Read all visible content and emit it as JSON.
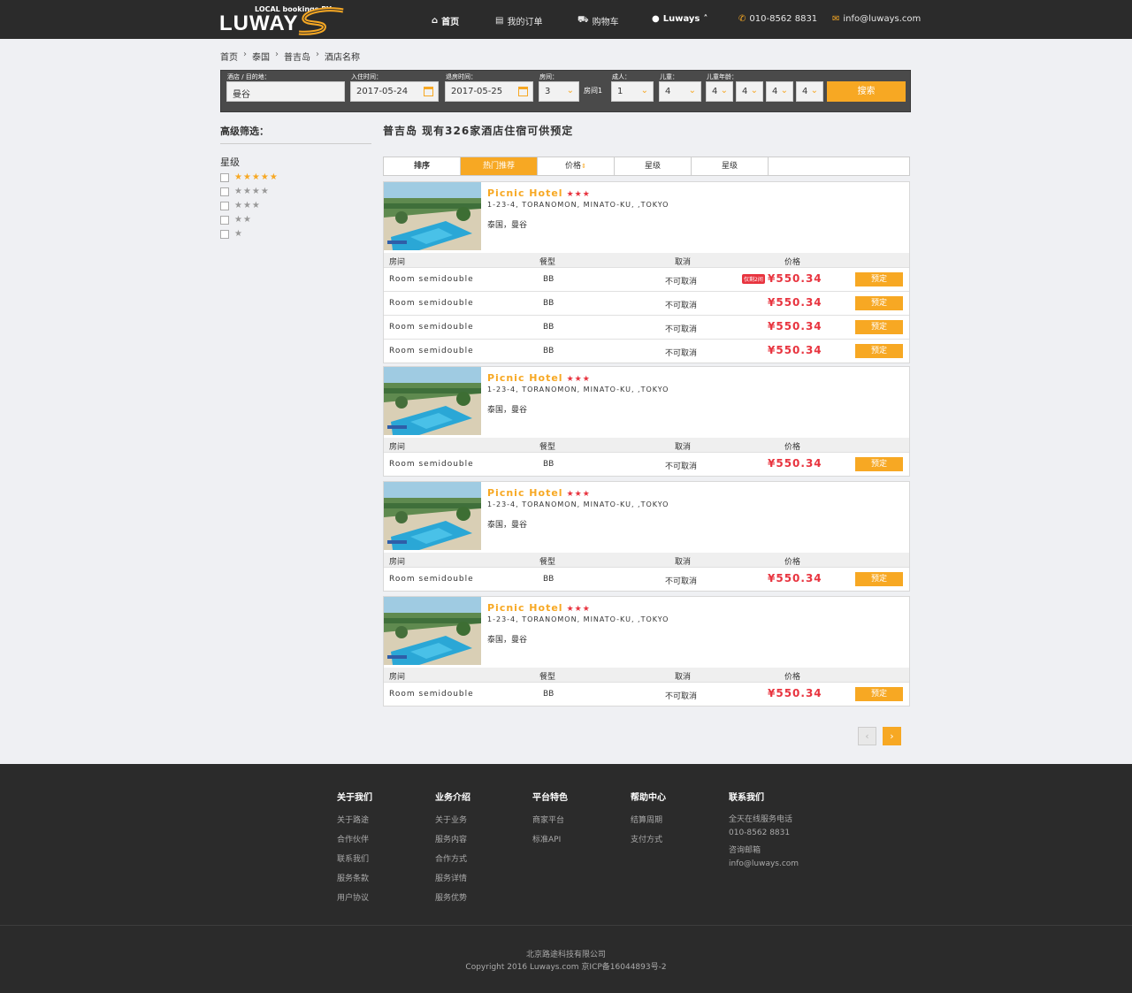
{
  "header": {
    "logo_small": "LOCAL bookings BY",
    "logo_text": "LUWAY",
    "nav": [
      {
        "label": "首页",
        "icon": "home-icon"
      },
      {
        "label": "我的订单",
        "icon": "list-icon"
      },
      {
        "label": "购物车",
        "icon": "cart-icon"
      },
      {
        "label": "Luways",
        "icon": "user-icon"
      }
    ],
    "phone": "010-8562 8831",
    "email": "info@luways.com"
  },
  "breadcrumb": [
    "首页",
    "泰国",
    "普吉岛",
    "酒店名称"
  ],
  "search": {
    "dest_label": "酒店 / 目的地：",
    "dest_value": "曼谷",
    "checkin_label": "入住时间：",
    "checkin_value": "2017-05-24",
    "checkout_label": "退房时间：",
    "checkout_value": "2017-05-25",
    "rooms_label": "房间：",
    "rooms_value": "3",
    "room_tag": "房间1",
    "adults_label": "成人：",
    "adults_value": "1",
    "children_label": "儿童：",
    "children_value": "4",
    "ages_label": "儿童年龄：",
    "ages": [
      "4",
      "4",
      "4",
      "4"
    ],
    "button": "搜索"
  },
  "filter": {
    "title": "高级筛选：",
    "star_label": "星级",
    "options": [
      5,
      4,
      3,
      2,
      1
    ]
  },
  "results": {
    "title": "普吉岛 现有326家酒店住宿可供预定"
  },
  "sort": [
    "排序",
    "热门推荐",
    "价格",
    "星级",
    "星级"
  ],
  "columns": {
    "room": "房间",
    "meal": "餐型",
    "cancel": "取消",
    "price": "价格"
  },
  "hotels": [
    {
      "name": "Picnic Hotel",
      "address": "1-23-4, TORANOMON, MINATO-KU, ,TOKYO",
      "location": "泰国，曼谷",
      "rooms": [
        {
          "room": "Room semidouble",
          "meal": "BB",
          "cancel": "不可取消",
          "price": "¥550.34",
          "badge": "仅剩2间",
          "book": "预定"
        },
        {
          "room": "Room semidouble",
          "meal": "BB",
          "cancel": "不可取消",
          "price": "¥550.34",
          "book": "预定"
        },
        {
          "room": "Room semidouble",
          "meal": "BB",
          "cancel": "不可取消",
          "price": "¥550.34",
          "book": "预定"
        },
        {
          "room": "Room semidouble",
          "meal": "BB",
          "cancel": "不可取消",
          "price": "¥550.34",
          "book": "预定"
        }
      ]
    },
    {
      "name": "Picnic Hotel",
      "address": "1-23-4, TORANOMON, MINATO-KU, ,TOKYO",
      "location": "泰国，曼谷",
      "rooms": [
        {
          "room": "Room semidouble",
          "meal": "BB",
          "cancel": "不可取消",
          "price": "¥550.34",
          "book": "预定"
        }
      ]
    },
    {
      "name": "Picnic Hotel",
      "address": "1-23-4, TORANOMON, MINATO-KU, ,TOKYO",
      "location": "泰国，曼谷",
      "rooms": [
        {
          "room": "Room semidouble",
          "meal": "BB",
          "cancel": "不可取消",
          "price": "¥550.34",
          "book": "预定"
        }
      ]
    },
    {
      "name": "Picnic Hotel",
      "address": "1-23-4, TORANOMON, MINATO-KU, ,TOKYO",
      "location": "泰国，曼谷",
      "rooms": [
        {
          "room": "Room semidouble",
          "meal": "BB",
          "cancel": "不可取消",
          "price": "¥550.34",
          "book": "预定"
        }
      ]
    }
  ],
  "pagination": {
    "prev": "‹",
    "next": "›"
  },
  "footer": {
    "about": {
      "title": "关于我们",
      "items": [
        "关于路途",
        "合作伙伴",
        "联系我们",
        "服务条款",
        "用户协议"
      ]
    },
    "business": {
      "title": "业务介绍",
      "items": [
        "关于业务",
        "服务内容",
        "合作方式",
        "服务详情",
        "服务优势"
      ]
    },
    "platform": {
      "title": "平台特色",
      "items": [
        "商家平台",
        "标准API"
      ]
    },
    "help": {
      "title": "帮助中心",
      "items": [
        "结算周期",
        "支付方式"
      ]
    },
    "contact": {
      "title": "联系我们",
      "phone_label": "全天在线服务电话",
      "phone": "010-8562 8831",
      "email_label": "咨询邮箱",
      "email": "info@luways.com"
    },
    "company": "北京路途科技有限公司",
    "copyright": "Copyright 2016 Luways.com 京ICP备16044893号-2"
  },
  "colors": {
    "accent": "#f7a823",
    "price": "#e8343f",
    "dark": "#2b2b2b",
    "page_bg": "#eff0f3"
  }
}
